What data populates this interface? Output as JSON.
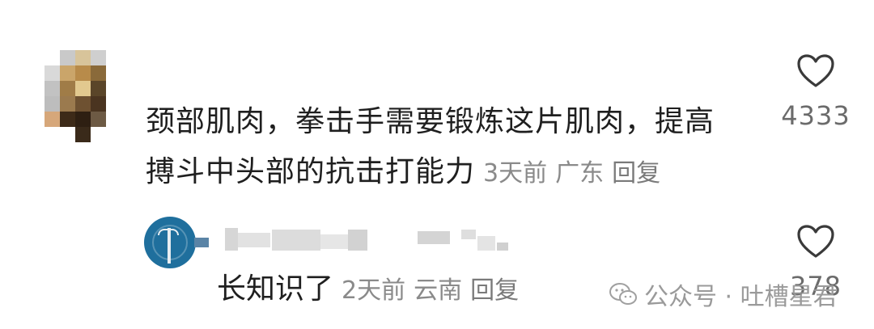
{
  "comment": {
    "text_line1": "颈部肌肉，拳击手需要锻炼这片肌肉，提高",
    "text_line2": "搏斗中头部的抗击打能力",
    "time": "3天前",
    "location": "广东",
    "reply_label": "回复",
    "like_count": "4333",
    "like_icon": "heart-outline-icon"
  },
  "reply": {
    "text": "长知识了",
    "time": "2天前",
    "location": "云南",
    "reply_label": "回复",
    "like_count": "378",
    "like_icon": "heart-outline-icon"
  },
  "watermark": {
    "text": "公众号 · 吐槽星君",
    "icon": "wechat-icon"
  },
  "colors": {
    "text": "#1f1f1f",
    "meta": "#8a8a8a",
    "icon_stroke": "#3a3a3a"
  }
}
